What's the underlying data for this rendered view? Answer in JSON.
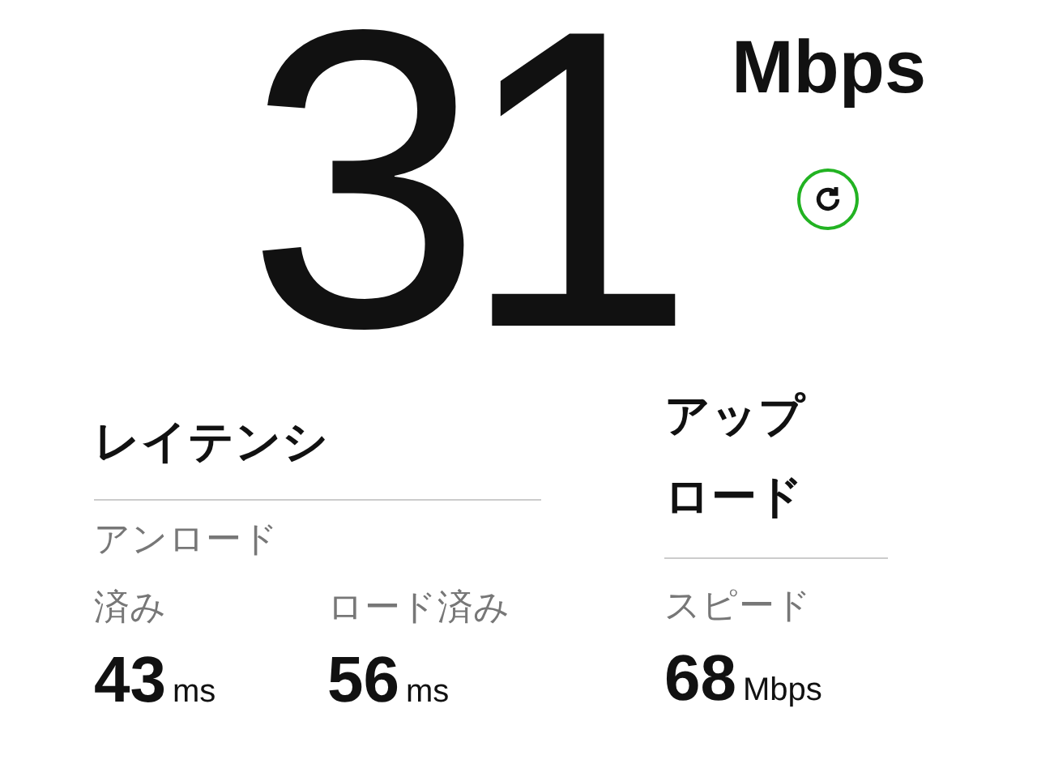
{
  "speed": {
    "value": "31",
    "unit": "Mbps"
  },
  "latency": {
    "title": "レイテンシ",
    "items": [
      {
        "label": "アンロード済み",
        "value": "43",
        "unit": "ms"
      },
      {
        "label": "ロード済み",
        "value": "56",
        "unit": "ms"
      }
    ]
  },
  "upload": {
    "title": "アップロード",
    "items": [
      {
        "label": "スピード",
        "value": "68",
        "unit": "Mbps"
      }
    ]
  }
}
